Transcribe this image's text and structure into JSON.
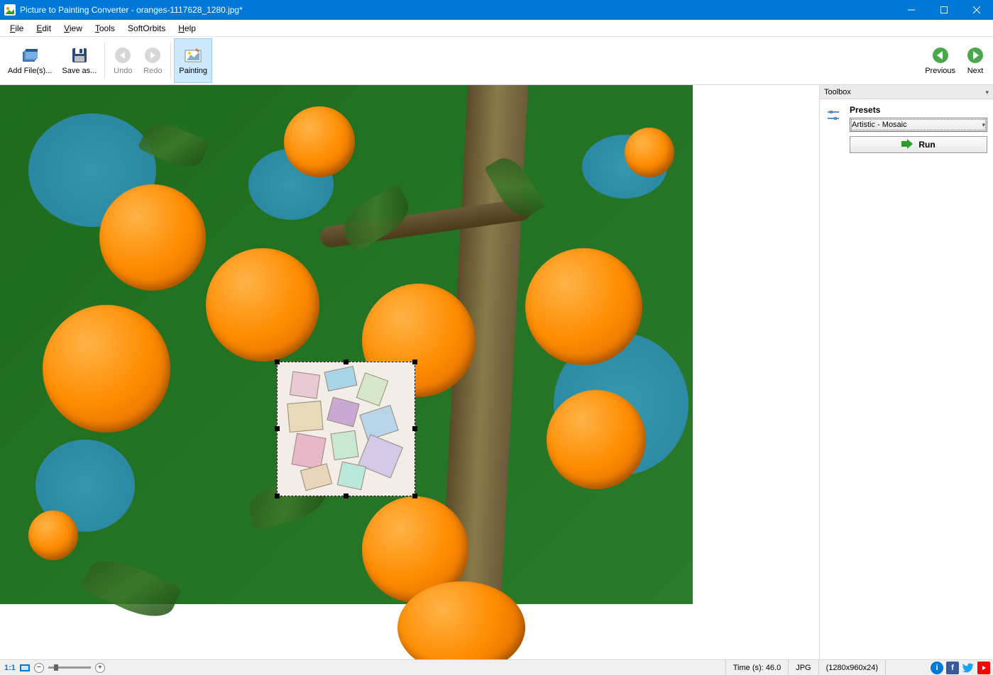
{
  "titlebar": {
    "title": "Picture to Painting Converter - oranges-1117628_1280.jpg*"
  },
  "menubar": {
    "file": "File",
    "edit": "Edit",
    "view": "View",
    "tools": "Tools",
    "softorbits": "SoftOrbits",
    "help": "Help"
  },
  "toolbar": {
    "add_files": "Add File(s)...",
    "save_as": "Save as...",
    "undo": "Undo",
    "redo": "Redo",
    "painting": "Painting",
    "previous": "Previous",
    "next": "Next"
  },
  "toolbox": {
    "header": "Toolbox",
    "presets_label": "Presets",
    "preset_value": "Artistic - Mosaic",
    "run_label": "Run"
  },
  "statusbar": {
    "ratio": "1:1",
    "time_label": "Time (s): 46.0",
    "format": "JPG",
    "dimensions": "(1280x960x24)"
  }
}
